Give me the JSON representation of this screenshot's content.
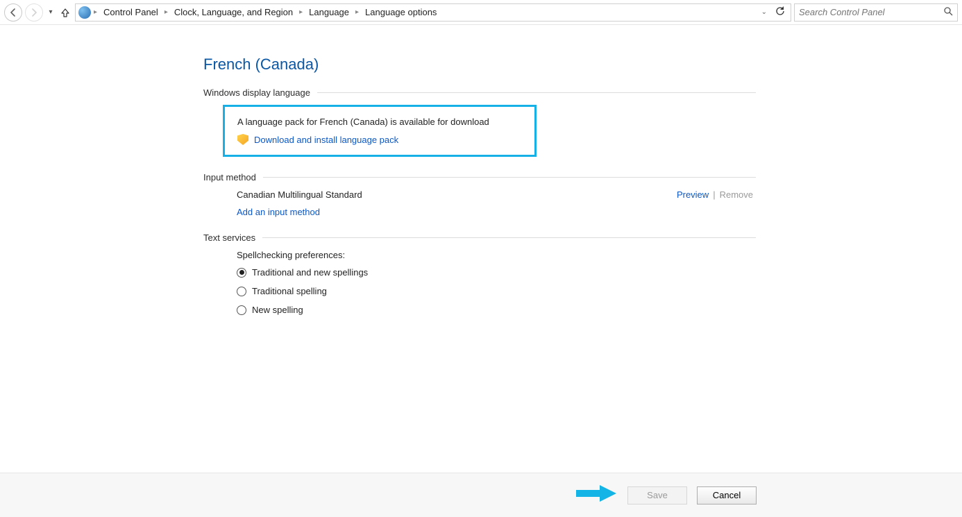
{
  "breadcrumb": [
    "Control Panel",
    "Clock, Language, and Region",
    "Language",
    "Language options"
  ],
  "search": {
    "placeholder": "Search Control Panel"
  },
  "page": {
    "title": "French (Canada)"
  },
  "display_lang": {
    "header": "Windows display language",
    "message": "A language pack for French (Canada) is available for download",
    "download_link": "Download and install language pack"
  },
  "input_method": {
    "header": "Input method",
    "current": "Canadian Multilingual Standard",
    "preview": "Preview",
    "separator": "|",
    "remove": "Remove",
    "add_link": "Add an input method"
  },
  "text_services": {
    "header": "Text services",
    "spell_label": "Spellchecking preferences:",
    "options": [
      "Traditional and new spellings",
      "Traditional spelling",
      "New spelling"
    ],
    "selected_index": 0
  },
  "footer": {
    "save": "Save",
    "cancel": "Cancel"
  }
}
